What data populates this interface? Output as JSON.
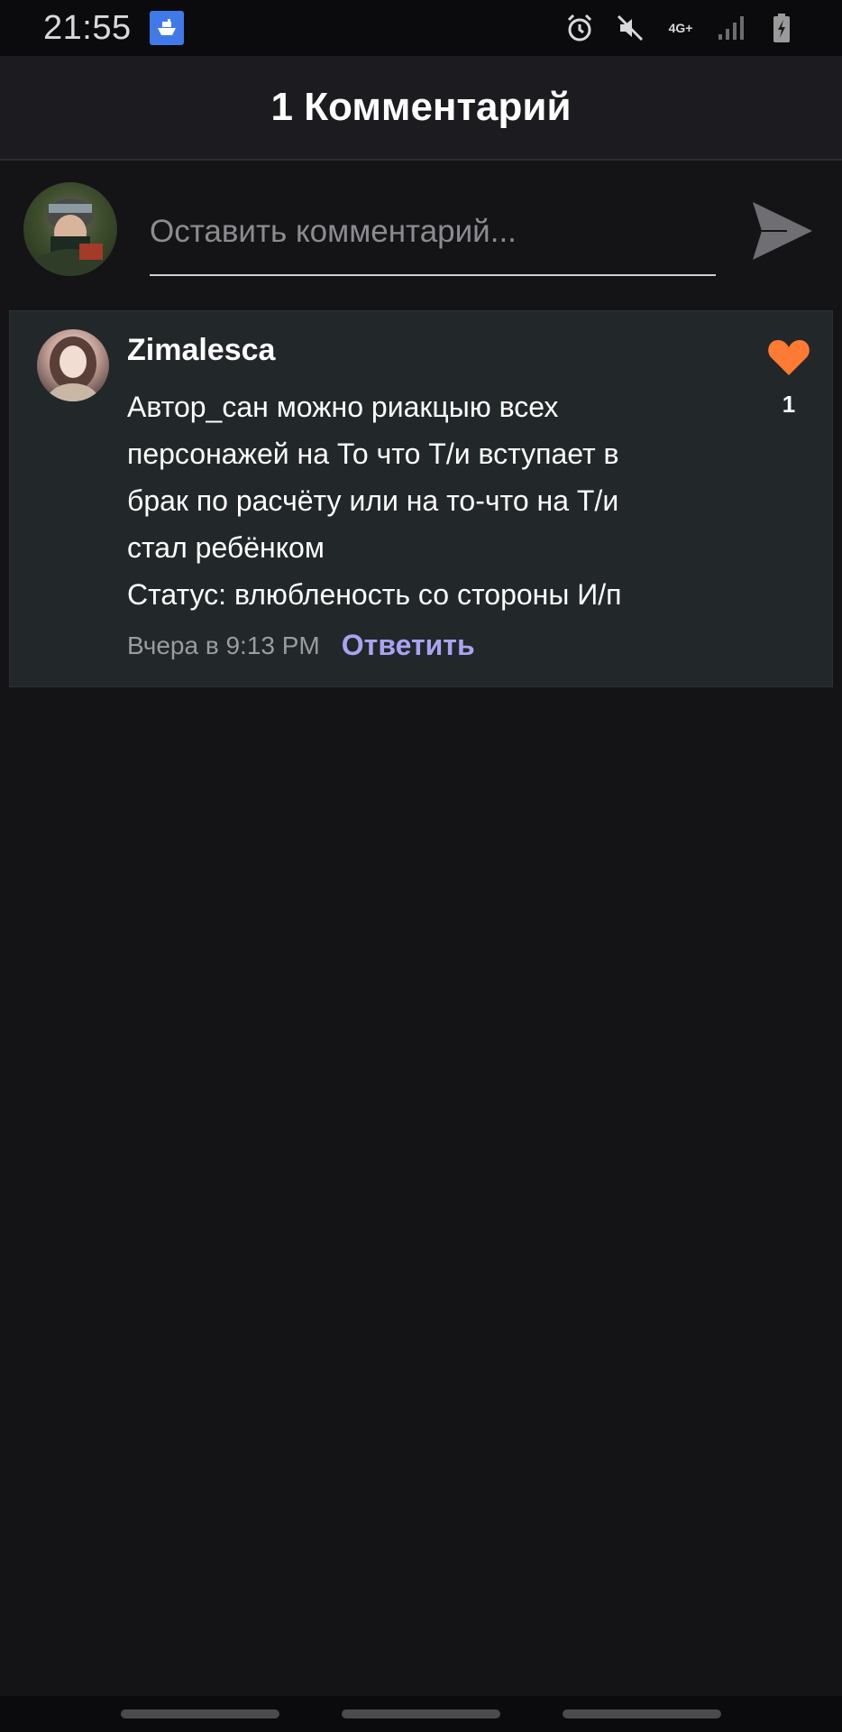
{
  "status_bar": {
    "time": "21:55",
    "app_icon": "boat-icon",
    "network_label": "4G+",
    "icons": [
      "alarm-icon",
      "mute-icon",
      "network-4g-icon",
      "signal-icon",
      "battery-charging-icon"
    ]
  },
  "header": {
    "title": "1 Комментарий"
  },
  "compose": {
    "placeholder": "Оставить комментарий...",
    "value": "",
    "send_icon": "send-icon"
  },
  "comments": [
    {
      "author": "Zimalesca",
      "lines": [
        "Автор_сан можно риакцыю всех",
        "персонажей на То что Т/и вступает в",
        "брак по расчёту или на то-что на Т/и",
        "стал ребёнком",
        "Статус:  влюбленость со стороны И/п"
      ],
      "time": "Вчера в 9:13 PM",
      "reply_label": "Ответить",
      "likes": "1",
      "like_icon": "heart-icon"
    }
  ],
  "colors": {
    "background": "#141316",
    "card": "#22272a",
    "accent_reply": "#a9a3f0",
    "like": "#ff7a33"
  }
}
